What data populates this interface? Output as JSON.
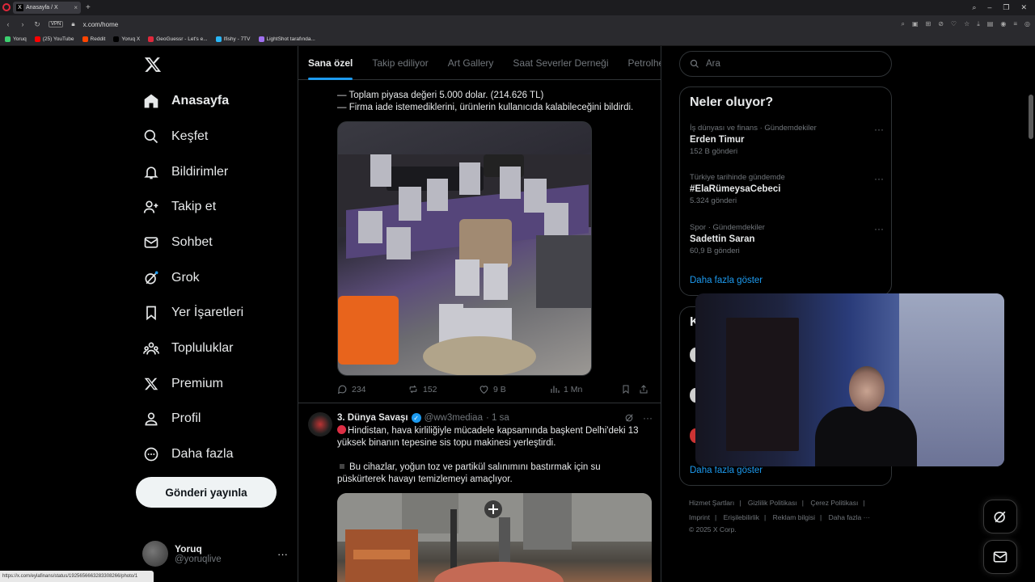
{
  "browser": {
    "tab_title": "Anasayfa / X",
    "url": "x.com/home",
    "vpn_label": "VPN",
    "bookmarks": [
      {
        "label": "Yoruq",
        "color": "#3cd070"
      },
      {
        "label": "(25) YouTube",
        "color": "#ff0000"
      },
      {
        "label": "Reddit",
        "color": "#ff4500"
      },
      {
        "label": "Yoruq X",
        "color": "#000000"
      },
      {
        "label": "GeoGuessr - Let's e...",
        "color": "#e0283b"
      },
      {
        "label": "Ifishy - 7TV",
        "color": "#29b6f6"
      },
      {
        "label": "LightShot tarafında...",
        "color": "#a070f0"
      }
    ],
    "status_url": "https://x.com/eylafinans/status/1925656663283308266/photo/1"
  },
  "nav": {
    "items": [
      {
        "label": "Anasayfa",
        "icon": "home-icon"
      },
      {
        "label": "Keşfet",
        "icon": "search-icon"
      },
      {
        "label": "Bildirimler",
        "icon": "bell-icon"
      },
      {
        "label": "Takip et",
        "icon": "follow-icon"
      },
      {
        "label": "Sohbet",
        "icon": "mail-icon"
      },
      {
        "label": "Grok",
        "icon": "grok-icon"
      },
      {
        "label": "Yer İşaretleri",
        "icon": "bookmark-icon"
      },
      {
        "label": "Topluluklar",
        "icon": "communities-icon"
      },
      {
        "label": "Premium",
        "icon": "x-logo-icon"
      },
      {
        "label": "Profil",
        "icon": "profile-icon"
      },
      {
        "label": "Daha fazla",
        "icon": "more-circle-icon"
      }
    ],
    "post_button": "Gönderi yayınla",
    "profile": {
      "name": "Yoruq",
      "handle": "@yoruqlive"
    }
  },
  "main": {
    "tabs": [
      "Sana özel",
      "Takip ediliyor",
      "Art Gallery",
      "Saat Severler Derneği",
      "Petrolhea"
    ],
    "tweet1": {
      "line1": "— Toplam piyasa değeri 5.000 dolar. (214.626 TL)",
      "line2": "— Firma iade istemediklerini, ürünlerin kullanıcıda kalabileceğini bildirdi.",
      "replies": "234",
      "reposts": "152",
      "likes": "9 B",
      "views": "1 Mn"
    },
    "tweet2": {
      "name": "3. Dünya Savaşı",
      "handle": "@ww3mediaa",
      "time": "· 1 sa",
      "para1_line1": "Hindistan, hava kirliliğiyle mücadele kapsamında başkent Delhi'deki 13",
      "para1_line2": "yüksek binanın tepesine sis topu makinesi yerleştirdi.",
      "para2_line1": "Bu cihazlar, yoğun toz ve partikül salınımını bastırmak için su",
      "para2_line2": "püskürterek havayı temizlemeyi amaçlıyor."
    }
  },
  "right": {
    "search_placeholder": "Ara",
    "trends_title": "Neler oluyor?",
    "trends": [
      {
        "context": "İş dünyası ve finans · Gündemdekiler",
        "name": "Erden Timur",
        "count": "152 B gönderi"
      },
      {
        "context": "Türkiye tarihinde gündemde",
        "name": "#ElaRümeysaCebeci",
        "count": "5.324 gönderi"
      },
      {
        "context": "Spor · Gündemdekiler",
        "name": "Sadettin Saran",
        "count": "60,9 B gönderi"
      }
    ],
    "show_more": "Daha fazla göster",
    "wtf_title_initial": "K",
    "wtf_show_more": "Daha fazla göster",
    "footer": {
      "links_row1": [
        "Hizmet Şartları",
        "Gizlilik Politikası",
        "Çerez Politikası"
      ],
      "links_row2": [
        "Imprint",
        "Erişilebilirlik",
        "Reklam bilgisi",
        "Daha fazla ···"
      ],
      "copyright": "© 2025 X Corp."
    }
  }
}
